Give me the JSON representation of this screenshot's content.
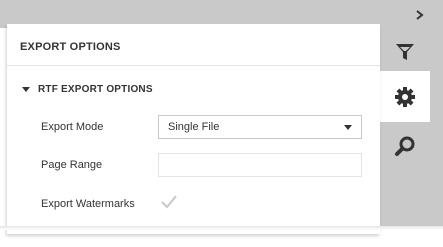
{
  "panel": {
    "title": "EXPORT OPTIONS",
    "section": {
      "title": "RTF EXPORT OPTIONS",
      "fields": {
        "export_mode": {
          "label": "Export Mode",
          "value": "Single File"
        },
        "page_range": {
          "label": "Page Range",
          "value": "",
          "placeholder": ""
        },
        "export_watermarks": {
          "label": "Export Watermarks",
          "checked": true
        }
      }
    }
  },
  "sidebar": {
    "collapse_icon": "chevron-right-icon",
    "tabs": [
      {
        "icon": "filter-icon",
        "active": false
      },
      {
        "icon": "gear-icon",
        "active": true
      },
      {
        "icon": "search-icon",
        "active": false
      }
    ]
  },
  "colors": {
    "chrome_grey": "#c9c9c9",
    "text": "#333333",
    "icon": "#333333",
    "checkmark_disabled": "#c7c7c7"
  }
}
